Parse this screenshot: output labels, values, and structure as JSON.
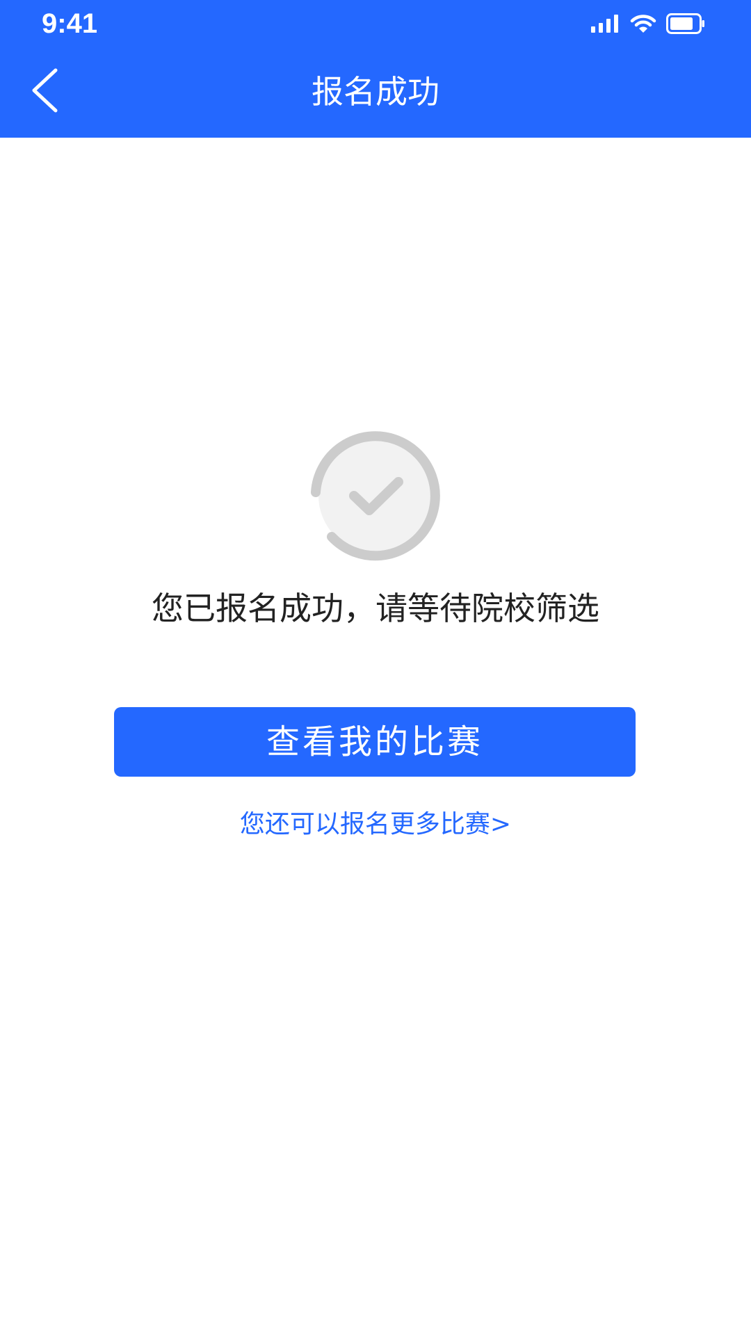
{
  "status_bar": {
    "time": "9:41",
    "icons": [
      "signal-icon",
      "wifi-icon",
      "battery-icon"
    ]
  },
  "nav": {
    "back_icon": "chevron-left-icon",
    "title": "报名成功"
  },
  "result": {
    "icon": "check-circle-icon",
    "message": "您已报名成功，请等待院校筛选"
  },
  "actions": {
    "view_my_contests_label": "查看我的比赛",
    "more_contests_link": "您还可以报名更多比赛>"
  },
  "colors": {
    "primary": "#2468FF",
    "icon_gray": "#CCCCCC",
    "icon_fill": "#F2F2F2",
    "text": "#222222"
  }
}
